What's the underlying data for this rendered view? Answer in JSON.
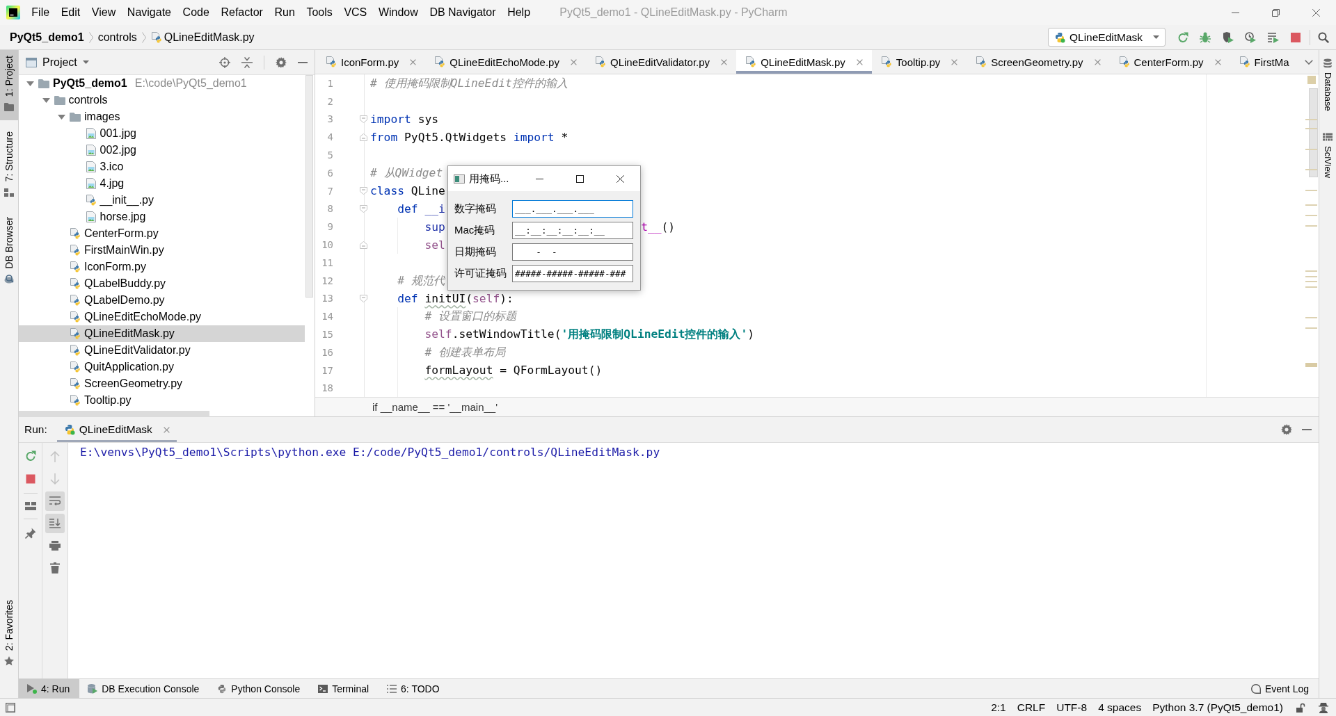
{
  "window": {
    "title": "PyQt5_demo1 - QLineEditMask.py - PyCharm"
  },
  "menu": [
    "File",
    "Edit",
    "View",
    "Navigate",
    "Code",
    "Refactor",
    "Run",
    "Tools",
    "VCS",
    "Window",
    "DB Navigator",
    "Help"
  ],
  "nav_bar": {
    "breadcrumbs": [
      {
        "label": "PyQt5_demo1",
        "kind": "project"
      },
      {
        "label": "controls",
        "kind": "folder"
      },
      {
        "label": "QLineEditMask.py",
        "kind": "python"
      }
    ],
    "run_config": "QLineEditMask"
  },
  "left_stripe": {
    "top": [
      {
        "label": "1: Project",
        "kind": "project",
        "selected": true
      },
      {
        "label": "7: Structure",
        "kind": "structure",
        "selected": false
      },
      {
        "label": "DB Browser",
        "kind": "db_browser",
        "selected": false
      }
    ],
    "bottom": [
      {
        "label": "2: Favorites",
        "kind": "favorites",
        "selected": false
      }
    ]
  },
  "project_panel": {
    "title": "Project",
    "tree": [
      {
        "name": "PyQt5_demo1",
        "path": "E:\\code\\PyQt5_demo1",
        "kind": "project",
        "expanded": true,
        "selected": false,
        "children": [
          {
            "name": "controls",
            "kind": "folder",
            "expanded": true,
            "selected": false,
            "children": [
              {
                "name": "images",
                "kind": "folder",
                "expanded": true,
                "selected": false,
                "children": [
                  {
                    "name": "001.jpg",
                    "kind": "image",
                    "selected": false
                  },
                  {
                    "name": "002.jpg",
                    "kind": "image",
                    "selected": false
                  },
                  {
                    "name": "3.ico",
                    "kind": "image",
                    "selected": false
                  },
                  {
                    "name": "4.jpg",
                    "kind": "image",
                    "selected": false
                  },
                  {
                    "name": "__init__.py",
                    "kind": "python",
                    "selected": false
                  },
                  {
                    "name": "horse.jpg",
                    "kind": "image",
                    "selected": false
                  }
                ]
              },
              {
                "name": "CenterForm.py",
                "kind": "python",
                "selected": false
              },
              {
                "name": "FirstMainWin.py",
                "kind": "python",
                "selected": false
              },
              {
                "name": "IconForm.py",
                "kind": "python",
                "selected": false
              },
              {
                "name": "QLabelBuddy.py",
                "kind": "python",
                "selected": false
              },
              {
                "name": "QLabelDemo.py",
                "kind": "python",
                "selected": false
              },
              {
                "name": "QLineEditEchoMode.py",
                "kind": "python",
                "selected": false
              },
              {
                "name": "QLineEditMask.py",
                "kind": "python",
                "selected": true
              },
              {
                "name": "QLineEditValidator.py",
                "kind": "python",
                "selected": false
              },
              {
                "name": "QuitApplication.py",
                "kind": "python",
                "selected": false
              },
              {
                "name": "ScreenGeometry.py",
                "kind": "python",
                "selected": false
              },
              {
                "name": "Tooltip.py",
                "kind": "python",
                "selected": false
              }
            ]
          }
        ]
      }
    ]
  },
  "editor": {
    "tabs": [
      {
        "label": "IconForm.py",
        "selected": false
      },
      {
        "label": "QLineEditEchoMode.py",
        "selected": false
      },
      {
        "label": "QLineEditValidator.py",
        "selected": false
      },
      {
        "label": "QLineEditMask.py",
        "selected": true
      },
      {
        "label": "Tooltip.py",
        "selected": false
      },
      {
        "label": "ScreenGeometry.py",
        "selected": false
      },
      {
        "label": "CenterForm.py",
        "selected": false
      },
      {
        "label": "FirstMa",
        "selected": false
      }
    ],
    "lines": [
      {
        "number": "1",
        "kind": "plain",
        "tokens": [
          {
            "kind": "comment",
            "text": "# 使用掩码限制QLineEdit控件的输入"
          }
        ]
      },
      {
        "number": "2",
        "kind": "plain"
      },
      {
        "number": "3",
        "kind": "fold_start",
        "tokens": [
          {
            "kind": "keyword",
            "text": "import"
          },
          {
            "kind": "plain",
            "text": " sys"
          }
        ]
      },
      {
        "number": "4",
        "kind": "fold_end",
        "tokens": [
          {
            "kind": "keyword",
            "text": "from"
          },
          {
            "kind": "plain",
            "text": " PyQt5.QtWidgets "
          },
          {
            "kind": "keyword",
            "text": "import"
          },
          {
            "kind": "plain",
            "text": " *"
          }
        ]
      },
      {
        "number": "5",
        "kind": "plain"
      },
      {
        "number": "6",
        "kind": "plain",
        "tokens": [
          {
            "kind": "comment",
            "text": "# 从QWidget"
          }
        ]
      },
      {
        "number": "7",
        "kind": "fold_start",
        "tokens": [
          {
            "kind": "keyword",
            "text": "class"
          },
          {
            "kind": "plain",
            "text": " QLine"
          }
        ],
        "children": [
          {
            "number": "8",
            "kind": "fold_start",
            "tokens": [
              {
                "kind": "keyword",
                "text": "def"
              },
              {
                "kind": "builtin",
                "text": " __i"
              }
            ],
            "children": [
              {
                "number": "9",
                "kind": "plain",
                "tokens": [
                  {
                    "kind": "builtin",
                    "text": "sup"
                  }
                ],
                "after_dialog": [
                  {
                    "kind": "predefined",
                    "text": "t__"
                  },
                  {
                    "kind": "plain",
                    "text": "()"
                  }
                ]
              },
              {
                "number": "10",
                "kind": "fold_end",
                "tokens": [
                  {
                    "kind": "self",
                    "text": "sel"
                  }
                ]
              }
            ]
          },
          {
            "number": "11",
            "kind": "plain"
          },
          {
            "number": "12",
            "kind": "plain",
            "tokens": [
              {
                "kind": "comment",
                "text": "# 规范代"
              }
            ]
          },
          {
            "number": "13",
            "kind": "fold_start",
            "tokens": [
              {
                "kind": "keyword",
                "text": "def "
              },
              {
                "kind": "warning",
                "text": "initUI"
              },
              {
                "kind": "plain",
                "text": "("
              },
              {
                "kind": "self",
                "text": "self"
              },
              {
                "kind": "plain",
                "text": "):"
              }
            ],
            "children": [
              {
                "number": "14",
                "kind": "plain",
                "tokens": [
                  {
                    "kind": "comment",
                    "text": "# 设置窗口的标题"
                  }
                ]
              },
              {
                "number": "15",
                "kind": "plain",
                "tokens": [
                  {
                    "kind": "self",
                    "text": "self"
                  },
                  {
                    "kind": "plain",
                    "text": ".setWindowTitle("
                  },
                  {
                    "kind": "string",
                    "text": "'用掩码限制QLineEdit控件的输入'"
                  },
                  {
                    "kind": "plain",
                    "text": ")"
                  }
                ]
              },
              {
                "number": "16",
                "kind": "plain",
                "tokens": [
                  {
                    "kind": "comment",
                    "text": "# 创建表单布局"
                  }
                ]
              },
              {
                "number": "17",
                "kind": "plain",
                "tokens": [
                  {
                    "kind": "warning",
                    "text": "formLayout"
                  },
                  {
                    "kind": "plain",
                    "text": " = QFormLayout()"
                  }
                ]
              },
              {
                "number": "18",
                "kind": "plain"
              }
            ]
          }
        ]
      }
    ],
    "breadcrumb": "if __name__ == '__main__'"
  },
  "dialog": {
    "title": "用掩码...",
    "fields": [
      {
        "label": "数字掩码",
        "value": "___.___.___.___",
        "focused": true
      },
      {
        "label": "Mac掩码",
        "value": "__:__:__:__:__:__",
        "focused": false
      },
      {
        "label": "日期掩码",
        "value": "    -  -",
        "focused": false
      },
      {
        "label": "许可证掩码",
        "value": "#####-#####-#####-###",
        "focused": false
      }
    ]
  },
  "right_stripe": [
    {
      "label": "Database",
      "kind": "database",
      "selected": false
    },
    {
      "label": "SciView",
      "kind": "sciview",
      "selected": false
    }
  ],
  "run_panel": {
    "label": "Run:",
    "tabs": [
      {
        "label": "QLineEditMask",
        "selected": true
      }
    ],
    "tools": [
      {
        "kind": "up",
        "disabled": true,
        "on": false
      },
      {
        "kind": "down",
        "disabled": true,
        "on": false
      },
      {
        "kind": "wrap",
        "disabled": false,
        "on": true
      },
      {
        "kind": "scroll",
        "disabled": false,
        "on": true
      },
      {
        "kind": "print",
        "disabled": false,
        "on": false
      },
      {
        "kind": "clear",
        "disabled": false,
        "on": false
      }
    ],
    "output": [
      "E:\\venvs\\PyQt5_demo1\\Scripts\\python.exe E:/code/PyQt5_demo1/controls/QLineEditMask.py"
    ]
  },
  "tool_bar": {
    "left": [
      {
        "label": "4: Run",
        "kind": "run",
        "selected": true
      },
      {
        "label": "DB Execution Console",
        "kind": "db_console",
        "selected": false
      },
      {
        "label": "Python Console",
        "kind": "python_console",
        "selected": false
      },
      {
        "label": "Terminal",
        "kind": "terminal",
        "selected": false
      },
      {
        "label": "6: TODO",
        "kind": "todo",
        "selected": false
      }
    ],
    "right": [
      {
        "label": "Event Log",
        "kind": "event_log",
        "selected": false
      }
    ]
  },
  "status_bar": [
    "2:1",
    "CRLF",
    "UTF-8",
    "4 spaces",
    "Python 3.7 (PyQt5_demo1)"
  ]
}
